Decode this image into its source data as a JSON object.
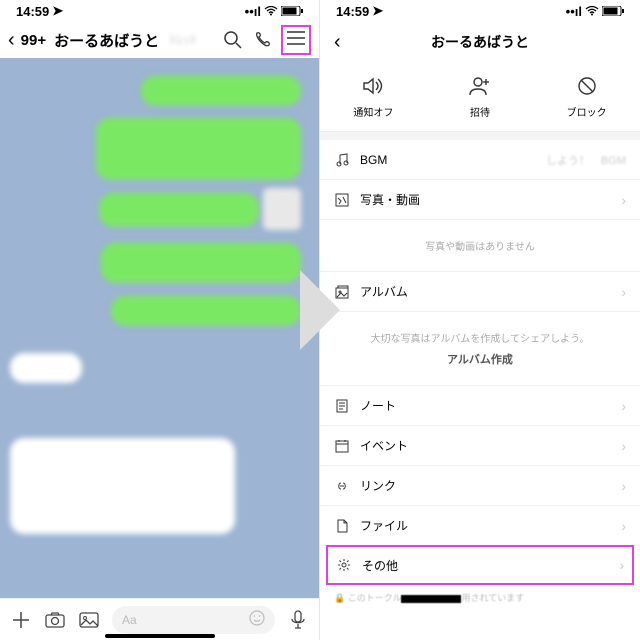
{
  "status": {
    "time": "14:59",
    "loc_arrow": "➤",
    "signal": "•ıl",
    "wifi": "⌔",
    "battery": "▬"
  },
  "left": {
    "back": "‹",
    "badge": "99+",
    "title": "おーるあばうと",
    "blur_sub": "ﾄﾚｯﾄ",
    "input_placeholder": "Aa"
  },
  "right": {
    "back": "‹",
    "title": "おーるあばうと",
    "actions": {
      "mute": "通知オフ",
      "invite": "招待",
      "block": "ブロック"
    },
    "rows": {
      "bgm": "BGM",
      "bgm_hint": "しよう！　BGM",
      "photos": "写真・動画",
      "photos_empty": "写真や動画はありません",
      "album": "アルバム",
      "album_empty1": "大切な写真はアルバムを作成してシェアしよう。",
      "album_empty2": "アルバム作成",
      "note": "ノート",
      "event": "イベント",
      "link": "リンク",
      "file": "ファイル",
      "other": "その他"
    },
    "footnote_prefix": "このトークル",
    "footnote_suffix": "用されています"
  }
}
